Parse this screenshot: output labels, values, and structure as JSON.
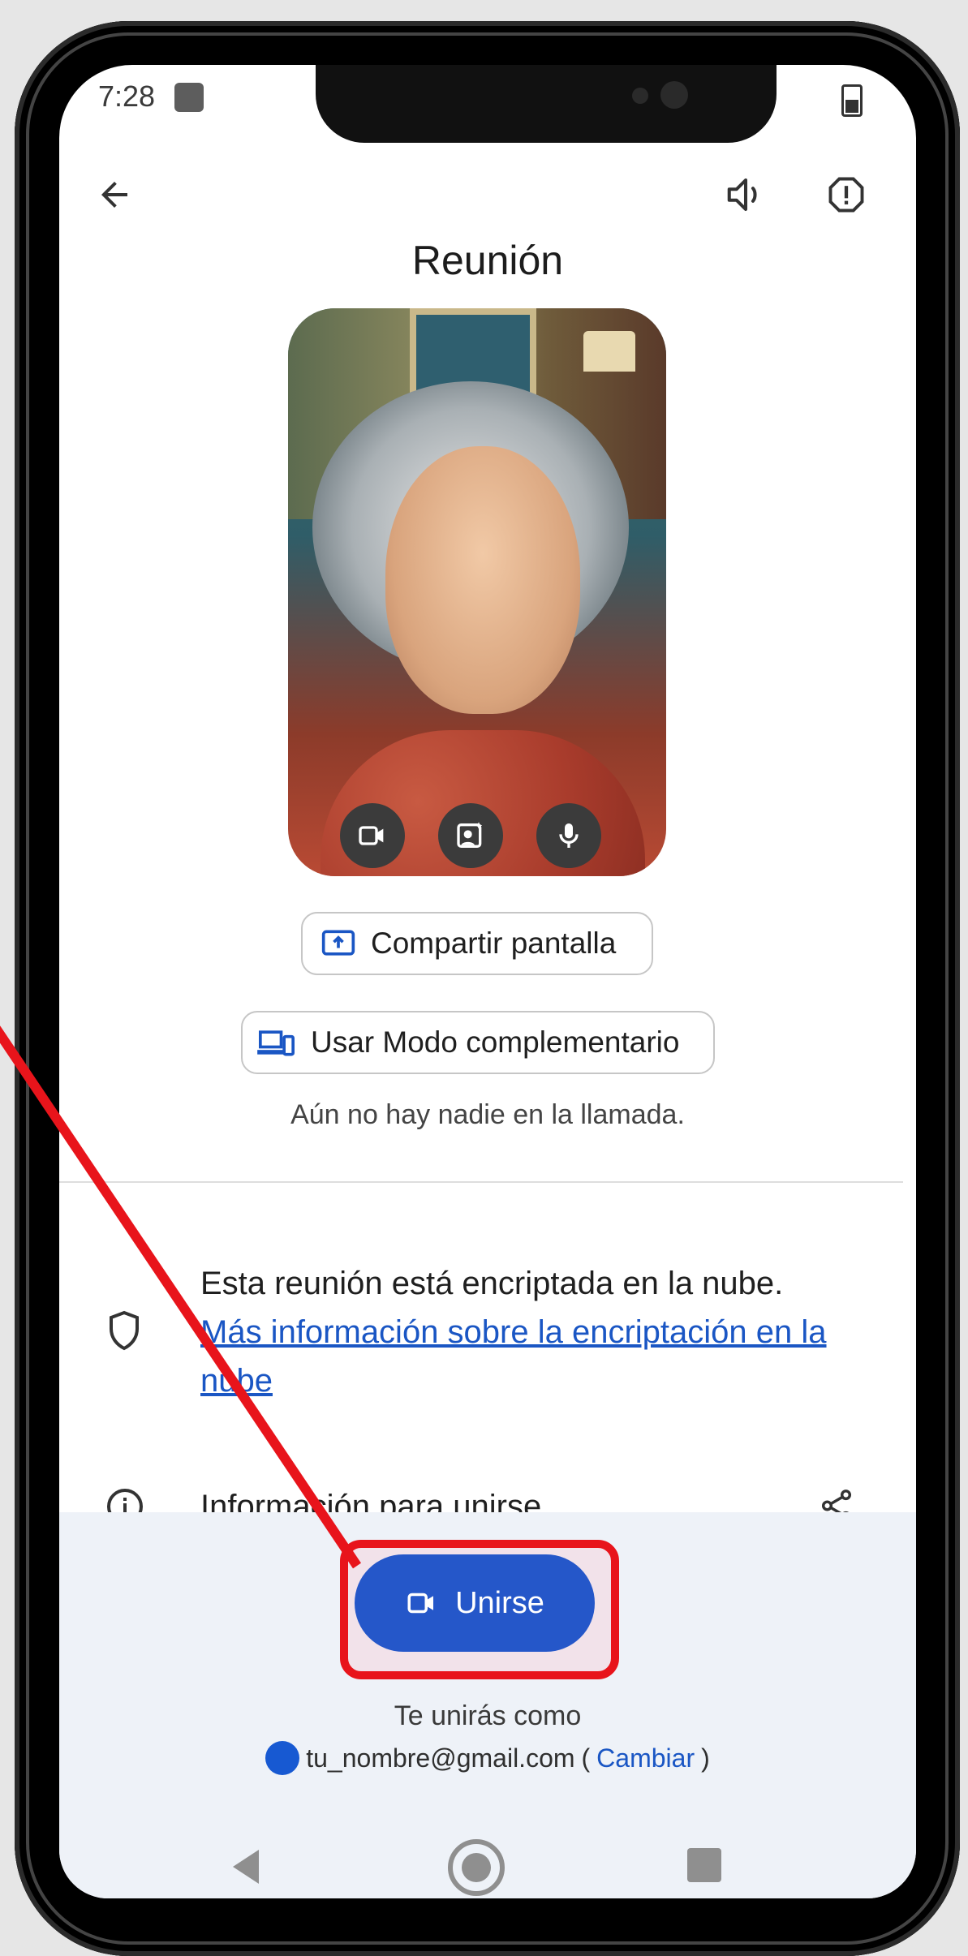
{
  "status_bar": {
    "time": "7:28"
  },
  "header": {
    "title": "Reunión"
  },
  "preview": {
    "controls": [
      "camera",
      "effects",
      "microphone"
    ]
  },
  "actions": {
    "share_screen": "Compartir pantalla",
    "companion_mode": "Usar Modo complementario"
  },
  "status_text": "Aún no hay nadie en la llamada.",
  "encryption": {
    "text": "Esta reunión está encriptada en la nube.",
    "link": "Más información sobre la encriptación en la nube"
  },
  "info": {
    "label": "Información para unirse"
  },
  "join": {
    "button": "Unirse",
    "joining_as": "Te unirás como",
    "email": "tu_nombre@gmail.com",
    "change": "Cambiar"
  },
  "colors": {
    "accent": "#2557c9",
    "highlight": "#e8141b",
    "link": "#1a56c4"
  }
}
